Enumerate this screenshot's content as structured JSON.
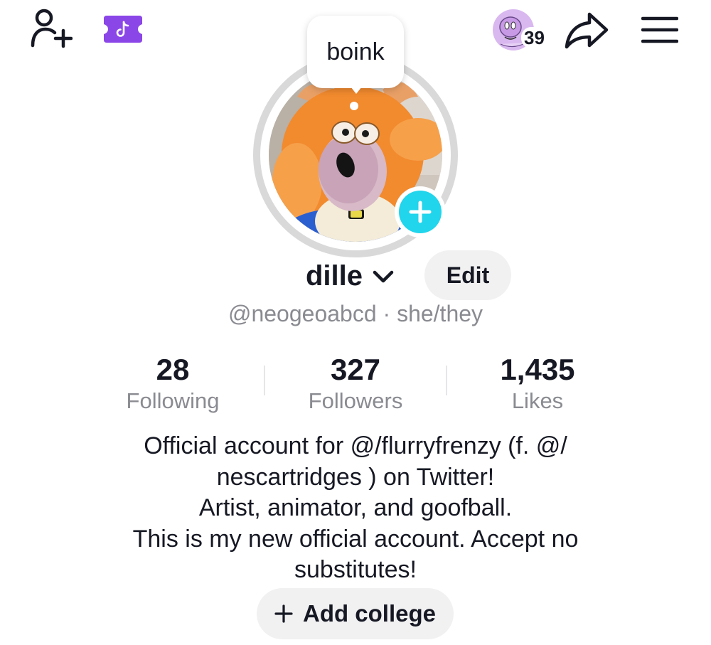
{
  "header": {
    "story_count": "39",
    "icons": {
      "add_friend": "person-plus-icon",
      "ticket": "tiktok-ticket-icon",
      "share": "share-arrow-icon",
      "menu": "hamburger-menu-icon"
    }
  },
  "profile": {
    "bubble_text": "boink",
    "display_name": "dille",
    "edit_label": "Edit",
    "handle_line": "@neogeoabcd · she/they"
  },
  "stats": [
    {
      "value": "28",
      "label": "Following"
    },
    {
      "value": "327",
      "label": "Followers"
    },
    {
      "value": "1,435",
      "label": "Likes"
    }
  ],
  "bio": [
    "Official account for @/flurryfrenzy (f. @/",
    "nescartridges ) on Twitter!",
    "Artist, animator, and goofball.",
    "This is my new official account. Accept no",
    "substitutes!"
  ],
  "college_button": {
    "label": "Add college"
  },
  "colors": {
    "accent_plus": "#20d5ec",
    "ticket_purple": "#8b46e8",
    "text_primary": "#161823",
    "text_secondary": "#8a8b91",
    "button_bg": "#f1f1f2"
  }
}
